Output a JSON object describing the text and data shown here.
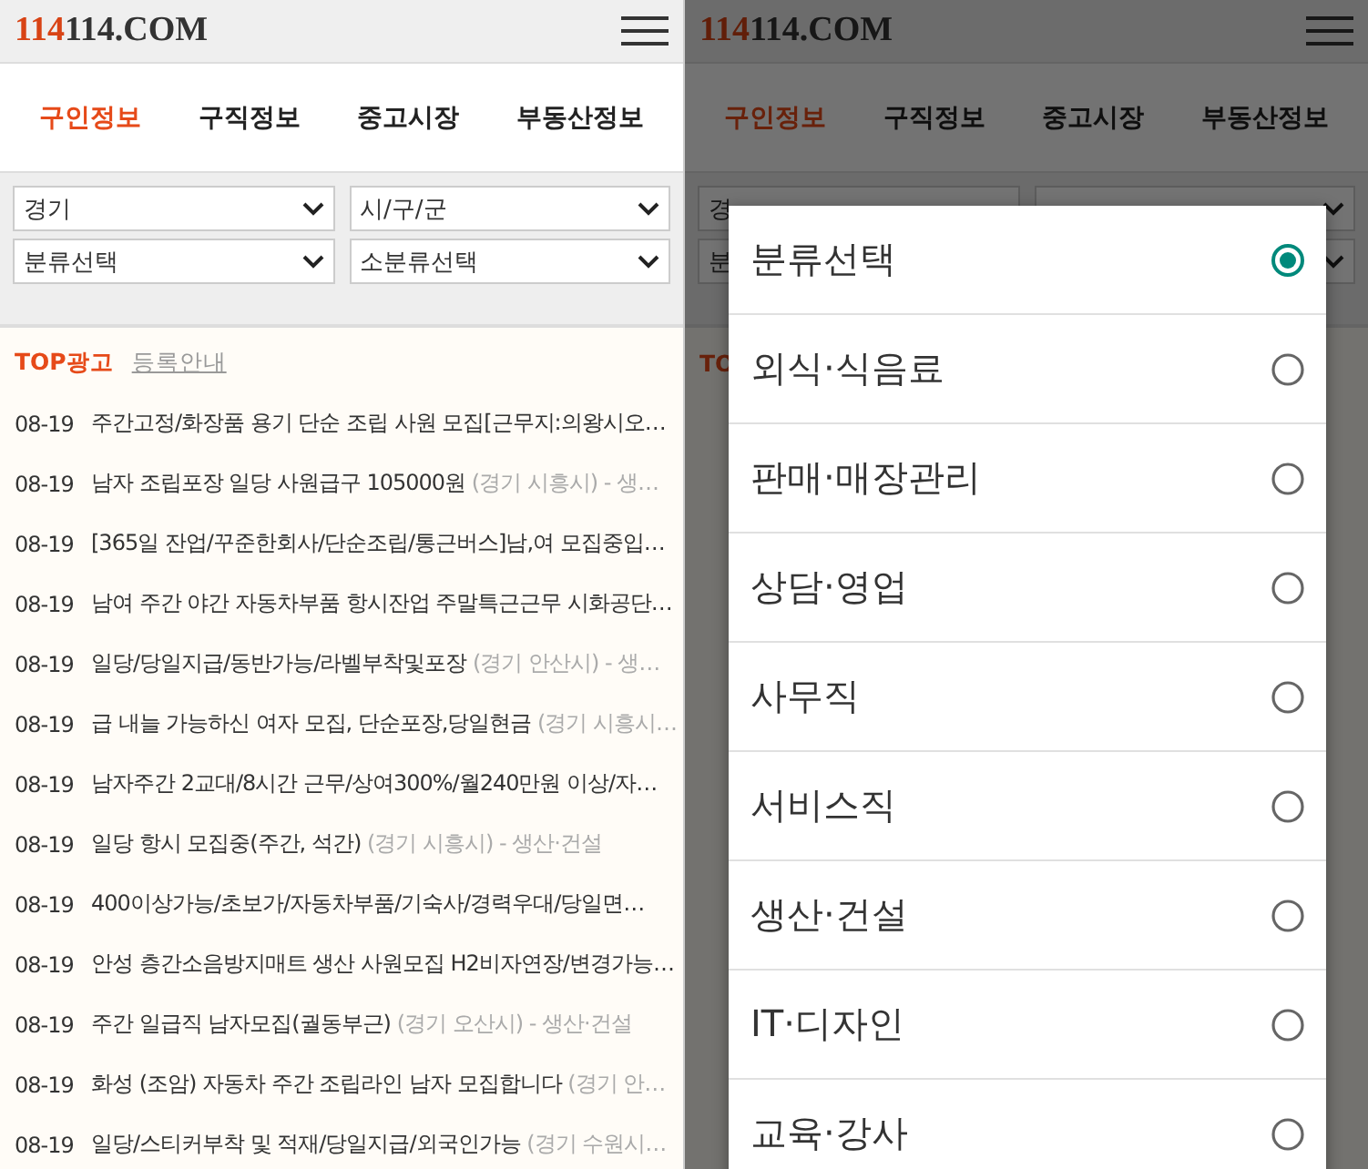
{
  "left_screen": {
    "logo": {
      "accent": "114",
      "rest": "114.COM"
    },
    "tabs": [
      {
        "label": "구인정보",
        "selected": true
      },
      {
        "label": "구직정보",
        "selected": false
      },
      {
        "label": "중고시장",
        "selected": false
      },
      {
        "label": "부동산정보",
        "selected": false
      }
    ],
    "filters": [
      {
        "value": "경기"
      },
      {
        "value": "시/구/군"
      },
      {
        "value": "분류선택"
      },
      {
        "value": "소분류선택"
      }
    ],
    "ad_header": {
      "title": "TOP광고",
      "link": "등록안내"
    },
    "listings": [
      {
        "date": "08-19",
        "title": "주간고정/화장품 용기 단순 조립 사원 모집[근무지:의왕시오…"
      },
      {
        "date": "08-19",
        "title": "남자 조립포장 일당 사원급구 105000원",
        "meta": "(경기 시흥시) - 생…"
      },
      {
        "date": "08-19",
        "title": "[365일 잔업/꾸준한회사/단순조립/통근버스]남,여 모집중입…"
      },
      {
        "date": "08-19",
        "title": "남여 주간 야간 자동차부품 항시잔업 주말특근근무 시화공단…"
      },
      {
        "date": "08-19",
        "title": "일당/당일지급/동반가능/라벨부착및포장",
        "meta": "(경기 안산시) - 생…"
      },
      {
        "date": "08-19",
        "title": "급 내늘 가능하신 여자 모집, 단순포장,당일현금",
        "meta": "(경기 시흥시…"
      },
      {
        "date": "08-19",
        "title": "남자주간 2교대/8시간 근무/상여300%/월240만원 이상/자…"
      },
      {
        "date": "08-19",
        "title": "일당 항시 모집중(주간, 석간)",
        "meta": "(경기 시흥시) - 생산·건설"
      },
      {
        "date": "08-19",
        "title": "400이상가능/초보가/자동차부품/기숙사/경력우대/당일면…"
      },
      {
        "date": "08-19",
        "title": "안성 층간소음방지매트 생산 사원모집 H2비자연장/변경가능…"
      },
      {
        "date": "08-19",
        "title": "주간 일급직 남자모집(궐동부근)",
        "meta": "(경기 오산시) - 생산·건설"
      },
      {
        "date": "08-19",
        "title": "화성 (조암) 자동차 주간 조립라인 남자 모집합니다",
        "meta": "(경기 안…"
      },
      {
        "date": "08-19",
        "title": "일당/스티커부착 및 적재/당일지급/외국인가능",
        "meta": "(경기 수원시…"
      }
    ]
  },
  "right_screen": {
    "logo": {
      "accent": "114",
      "rest": "114.COM"
    },
    "tabs": [
      {
        "label": "구인정보",
        "selected": true
      },
      {
        "label": "구직정보",
        "selected": false
      },
      {
        "label": "중고시장",
        "selected": false
      },
      {
        "label": "부동산정보",
        "selected": false
      }
    ],
    "filters": [
      {
        "value": "경"
      },
      {
        "value": "분"
      }
    ],
    "ad_header": {
      "title": "TO"
    },
    "dialog": {
      "options": [
        {
          "label": "분류선택",
          "selected": true
        },
        {
          "label": "외식·식음료",
          "selected": false
        },
        {
          "label": "판매·매장관리",
          "selected": false
        },
        {
          "label": "상담·영업",
          "selected": false
        },
        {
          "label": "사무직",
          "selected": false
        },
        {
          "label": "서비스직",
          "selected": false
        },
        {
          "label": "생산·건설",
          "selected": false
        },
        {
          "label": "IT·디자인",
          "selected": false
        },
        {
          "label": "교육·강사",
          "selected": false
        }
      ]
    }
  }
}
